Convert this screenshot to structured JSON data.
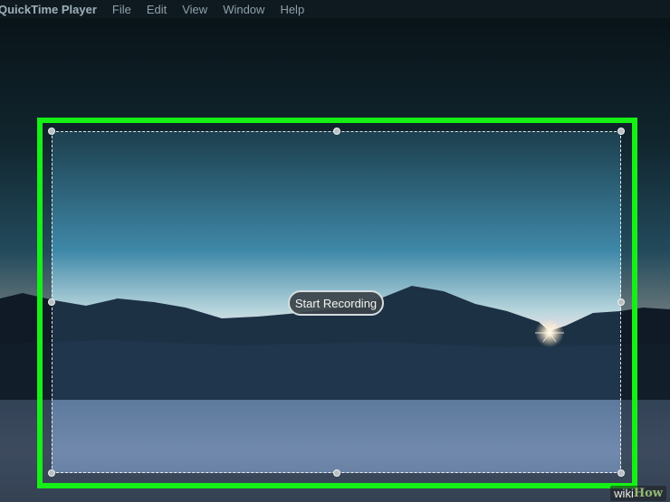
{
  "menubar": {
    "app_name": "QuickTime Player",
    "items": [
      "File",
      "Edit",
      "View",
      "Window",
      "Help"
    ]
  },
  "selection": {
    "button_label": "Start Recording",
    "outline_color": "#16f016"
  },
  "watermark": {
    "part1": "wiki",
    "part2": "How"
  }
}
